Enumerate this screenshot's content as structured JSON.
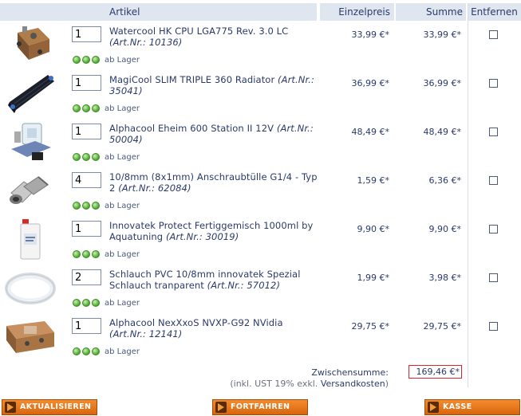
{
  "columns": {
    "artikel": "Artikel",
    "einzelpreis": "Einzelpreis",
    "summe": "Summe",
    "entfernen": "Entfernen"
  },
  "items": [
    {
      "qty": "1",
      "name": "Watercool HK CPU LGA775 Rev. 3.0 LC",
      "artnr": "(Art.Nr.: 10136)",
      "stock": "ab Lager",
      "price": "33,99 €*",
      "total": "33,99 €*",
      "image_icon": "cpu-waterblock-image"
    },
    {
      "qty": "1",
      "name": "MagiCool SLIM TRIPLE 360 Radiator",
      "artnr": "(Art.Nr.: 35041)",
      "stock": "ab Lager",
      "price": "36,99 €*",
      "total": "36,99 €*",
      "image_icon": "radiator-image"
    },
    {
      "qty": "1",
      "name": "Alphacool Eheim 600 Station II 12V",
      "artnr": "(Art.Nr.: 50004)",
      "stock": "ab Lager",
      "price": "48,49 €*",
      "total": "48,49 €*",
      "image_icon": "pump-station-image"
    },
    {
      "qty": "4",
      "name": "10/8mm (8x1mm) Anschraubtülle G1/4 - Typ 2",
      "artnr": "(Art.Nr.: 62084)",
      "stock": "ab Lager",
      "price": "1,59 €*",
      "total": "6,36 €*",
      "image_icon": "fitting-image"
    },
    {
      "qty": "1",
      "name": "Innovatek Protect Fertiggemisch 1000ml by Aquatuning",
      "artnr": "(Art.Nr.: 30019)",
      "stock": "ab Lager",
      "price": "9,90 €*",
      "total": "9,90 €*",
      "image_icon": "coolant-bottle-image"
    },
    {
      "qty": "2",
      "name": "Schlauch PVC 10/8mm innovatek Spezial Schlauch tranparent",
      "artnr": "(Art.Nr.: 57012)",
      "stock": "ab Lager",
      "price": "1,99 €*",
      "total": "3,98 €*",
      "image_icon": "tube-image"
    },
    {
      "qty": "1",
      "name": "Alphacool NexXxoS NVXP-G92 NVidia",
      "artnr": "(Art.Nr.: 12141)",
      "stock": "ab Lager",
      "price": "29,75 €*",
      "total": "29,75 €*",
      "image_icon": "gpu-waterblock-image"
    }
  ],
  "summary": {
    "label": "Zwischensumme:",
    "total": "169,46 €*",
    "note_prefix": "(inkl. UST 19% exkl.",
    "note_link": "Versandkosten",
    "note_suffix": ")"
  },
  "buttons": {
    "update": "AKTUALISIEREN",
    "continue": "FORTFAHREN",
    "checkout": "KASSE"
  },
  "colors": {
    "accent": "#e5761a",
    "header_bg": "#dfe6f0",
    "text": "#2a3a6a",
    "stock_green": "#4aa42c",
    "total_border": "#d9262e"
  }
}
